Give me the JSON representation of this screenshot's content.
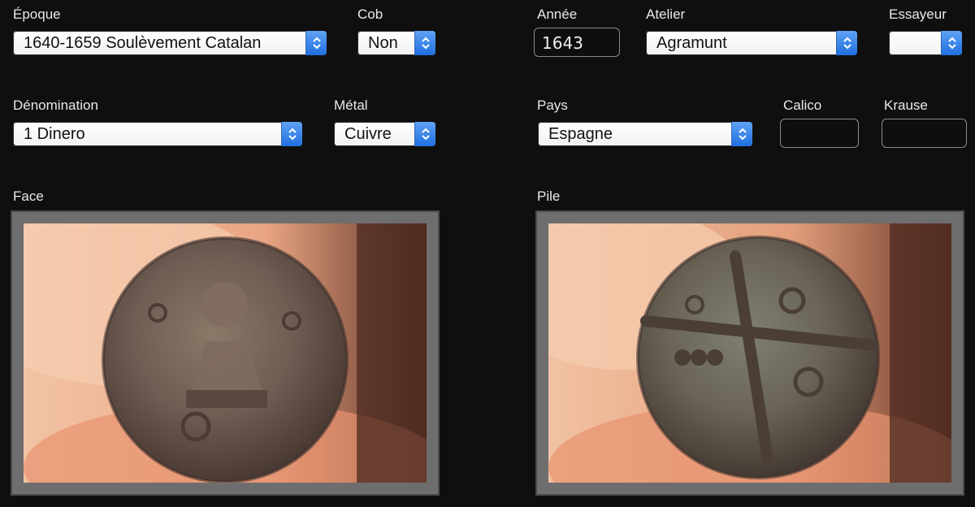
{
  "fields": {
    "epoque": {
      "label": "Époque",
      "value": "1640-1659 Soulèvement Catalan"
    },
    "cob": {
      "label": "Cob",
      "value": "Non"
    },
    "annee": {
      "label": "Année",
      "value": "1643"
    },
    "atelier": {
      "label": "Atelier",
      "value": "Agramunt"
    },
    "essayeur": {
      "label": "Essayeur",
      "value": ""
    },
    "denomination": {
      "label": "Dénomination",
      "value": "1 Dinero"
    },
    "metal": {
      "label": "Métal",
      "value": "Cuivre"
    },
    "pays": {
      "label": "Pays",
      "value": "Espagne"
    },
    "calico": {
      "label": "Calico",
      "value": ""
    },
    "krause": {
      "label": "Krause",
      "value": ""
    }
  },
  "images": {
    "face": {
      "label": "Face"
    },
    "pile": {
      "label": "Pile"
    }
  },
  "colors": {
    "background": "#0f0f0f",
    "stepper_blue": "#2f7fe8",
    "frame_gray": "#6e6e6e"
  },
  "icons": {
    "stepper": "up-down-chevron-icon"
  }
}
